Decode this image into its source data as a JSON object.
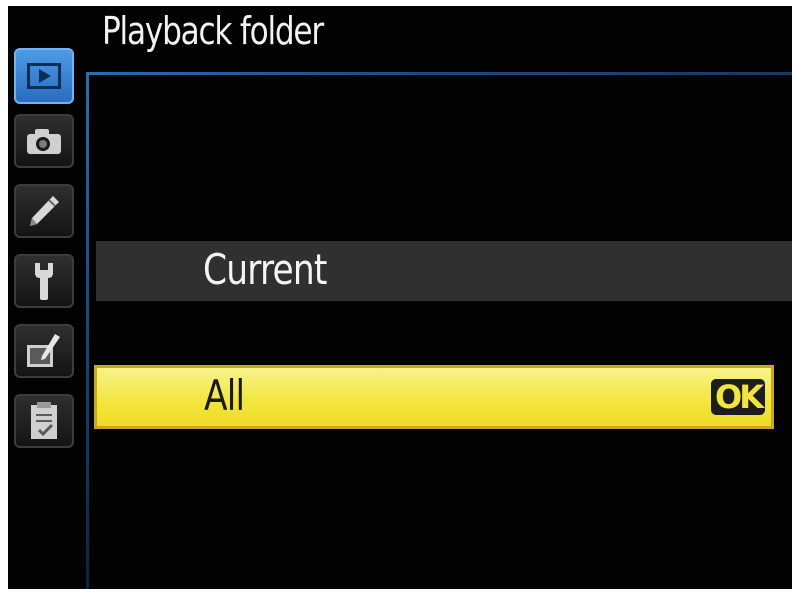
{
  "menu": {
    "title": "Playback folder",
    "tabs": [
      {
        "icon": "playback-icon",
        "active": true
      },
      {
        "icon": "camera-icon",
        "active": false
      },
      {
        "icon": "pencil-icon",
        "active": false
      },
      {
        "icon": "wrench-icon",
        "active": false
      },
      {
        "icon": "retouch-icon",
        "active": false
      },
      {
        "icon": "my-menu-icon",
        "active": false
      }
    ],
    "options": [
      {
        "label": "Current",
        "selected": false
      },
      {
        "label": "All",
        "selected": true
      }
    ],
    "ok_label": "OK"
  },
  "colors": {
    "frame": "#2a6db0",
    "active_tab": "#3f86d8",
    "highlight": "#f3e53c",
    "option_bg": "#303030"
  }
}
